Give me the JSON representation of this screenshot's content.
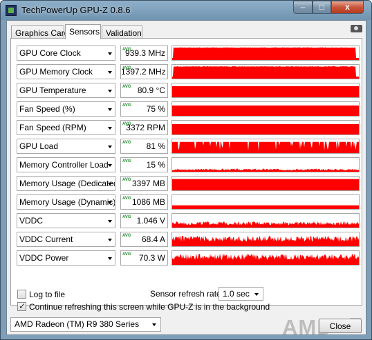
{
  "window": {
    "title": "TechPowerUp GPU-Z 0.8.6",
    "min_label": "‒",
    "max_label": "□",
    "close_label": "x"
  },
  "tabs": [
    {
      "label": "Graphics Card"
    },
    {
      "label": "Sensors"
    },
    {
      "label": "Validation"
    }
  ],
  "active_tab": "Sensors",
  "sensors": [
    {
      "label": "GPU Core Clock",
      "mode": "AVG",
      "value": "939.3 MHz",
      "fill_fraction": 0.92,
      "pattern": "high"
    },
    {
      "label": "GPU Memory Clock",
      "mode": "AVG",
      "value": "1397.2 MHz",
      "fill_fraction": 0.9,
      "pattern": "high"
    },
    {
      "label": "GPU Temperature",
      "mode": "AVG",
      "value": "80.9 °C",
      "fill_fraction": 0.8,
      "pattern": "flat"
    },
    {
      "label": "Fan Speed (%)",
      "mode": "AVG",
      "value": "75 %",
      "fill_fraction": 0.75,
      "pattern": "flat"
    },
    {
      "label": "Fan Speed (RPM)",
      "mode": "AVG",
      "value": "3372 RPM",
      "fill_fraction": 0.75,
      "pattern": "flat"
    },
    {
      "label": "GPU Load",
      "mode": "AVG",
      "value": "81 %",
      "fill_fraction": 0.81,
      "pattern": "spiky"
    },
    {
      "label": "Memory Controller Load",
      "mode": "AVG",
      "value": "15 %",
      "fill_fraction": 0.15,
      "pattern": "lownoise"
    },
    {
      "label": "Memory Usage (Dedicated)",
      "mode": "AVG",
      "value": "3397 MB",
      "fill_fraction": 0.82,
      "pattern": "flat"
    },
    {
      "label": "Memory Usage (Dynamic)",
      "mode": "AVG",
      "value": "1086 MB",
      "fill_fraction": 0.26,
      "pattern": "flat"
    },
    {
      "label": "VDDC",
      "mode": "AVG",
      "value": "1.046 V",
      "fill_fraction": 0.3,
      "pattern": "lownoise"
    },
    {
      "label": "VDDC Current",
      "mode": "AVG",
      "value": "68.4 A",
      "fill_fraction": 0.6,
      "pattern": "noisy"
    },
    {
      "label": "VDDC Power",
      "mode": "AVG",
      "value": "70.3 W",
      "fill_fraction": 0.65,
      "pattern": "noisy"
    }
  ],
  "options": {
    "log_to_file": {
      "label": "Log to file",
      "checked": false
    },
    "refresh_label": "Sensor refresh rate:",
    "refresh_value": "1.0 sec",
    "continue_refresh": {
      "label": "Continue refreshing this screen while GPU-Z is in the background",
      "checked": true
    }
  },
  "footer": {
    "gpu_select": "AMD Radeon (TM) R9 380 Series",
    "logo_text": "AMD",
    "close_label": "Close"
  },
  "colors": {
    "graph": "#ff0000",
    "avg_tag": "#1f8a2a"
  }
}
